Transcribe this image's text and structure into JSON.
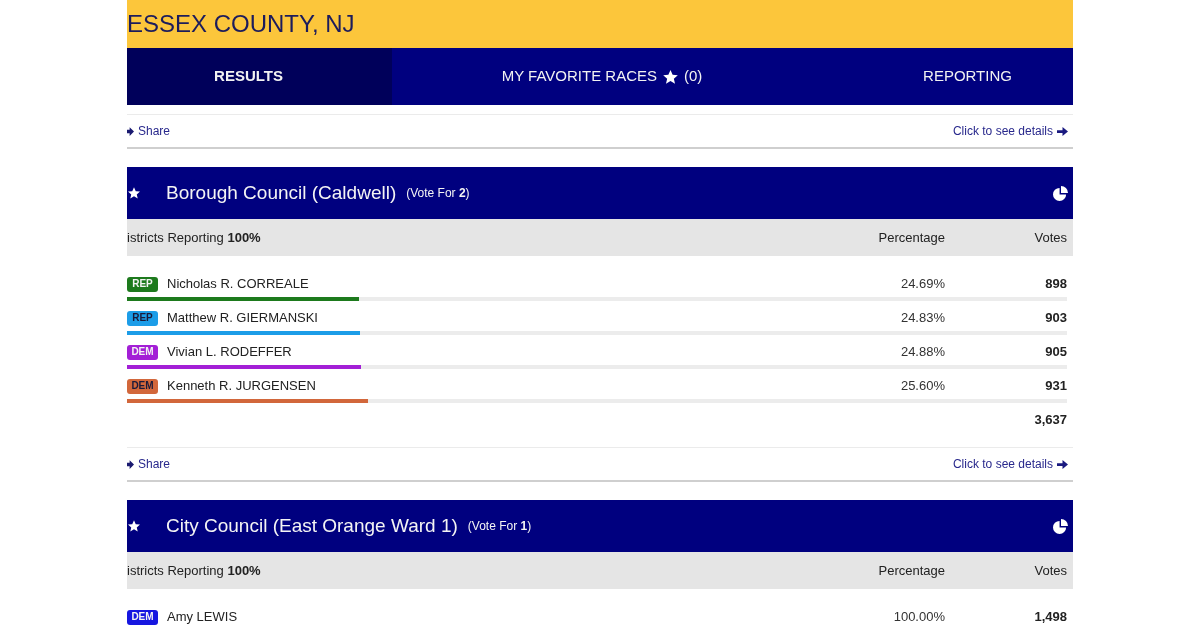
{
  "header": {
    "title": "ESSEX COUNTY, NJ"
  },
  "tabs": [
    {
      "label": "RESULTS",
      "selected": true
    },
    {
      "label": "MY FAVORITE RACES",
      "count": "(0)",
      "selected": false
    },
    {
      "label": "REPORTING",
      "selected": false
    }
  ],
  "previous_race_links": {
    "share": "Share",
    "details": "Click to see details"
  },
  "races": [
    {
      "title": "Borough Council (Caldwell)",
      "vote_for": "(Vote For **2**)",
      "districts_reporting": "istricts Reporting **100%**",
      "columns": [
        "Percentage",
        "Votes"
      ],
      "candidates": [
        {
          "party": "REP",
          "color": "#1d7a1d",
          "name": "Nicholas R. CORREALE",
          "percentage": "24.69%",
          "votes": "898",
          "level": 0.2469
        },
        {
          "party": "REP",
          "color": "#1c9de8",
          "name": "Matthew R. GIERMANSKI",
          "percentage": "24.83%",
          "votes": "903",
          "level": 0.2483
        },
        {
          "party": "DEM",
          "color": "#a31fd6",
          "name": "Vivian L. RODEFFER",
          "percentage": "24.88%",
          "votes": "905",
          "level": 0.2488
        },
        {
          "party": "DEM",
          "color": "#d2673b",
          "name": "Kenneth R. JURGENSEN",
          "percentage": "25.60%",
          "votes": "931",
          "level": 0.256
        }
      ],
      "total": "3,637",
      "links": {
        "share": "Share",
        "details": "Click to see details"
      }
    },
    {
      "title": "City Council (East Orange Ward 1)",
      "vote_for": "(Vote For **1**)",
      "districts_reporting": "istricts Reporting **100%**",
      "columns": [
        "Percentage",
        "Votes"
      ],
      "candidates": [
        {
          "party": "DEM",
          "color": "#1616e0",
          "name": "Amy LEWIS",
          "percentage": "100.00%",
          "votes": "1,498"
        }
      ]
    }
  ]
}
